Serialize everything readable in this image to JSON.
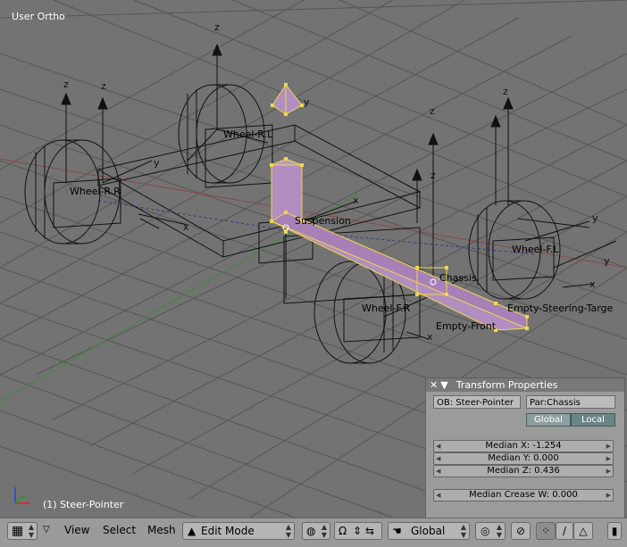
{
  "viewport": {
    "view_name": "User Ortho",
    "object_name": "(1) Steer-Pointer",
    "labels": {
      "suspension": "Suspension",
      "chassis": "Chassis",
      "empty_front": "Empty-Front",
      "empty_steering_target": "Empty-Steering-Targe",
      "wheel_fr": "Wheel-F.R",
      "wheel_fl": "Wheel-F.L",
      "wheel_rl": "Wheel-R.L",
      "wheel_rr": "Wheel-R.R"
    },
    "axis_letters": {
      "z": "z",
      "y": "y",
      "x": "x"
    }
  },
  "transform_panel": {
    "title": "Transform Properties",
    "ob_field": "OB: Steer-Pointer",
    "par_field": "Par:Chassis",
    "global_label": "Global",
    "local_label": "Local",
    "median_x": "Median X: -1.254",
    "median_y": "Median Y: 0.000",
    "median_z": "Median Z: 0.436",
    "median_crease": "Median Crease W: 0.000"
  },
  "header": {
    "menu_view": "View",
    "menu_select": "Select",
    "menu_mesh": "Mesh",
    "mode_label": "Edit Mode",
    "orientation_label": "Global"
  },
  "colors": {
    "viewport_bg": "#737373",
    "selection_fill": "#b08fc0",
    "selection_edge": "#f0d64a",
    "panel_bg": "#9b9b9b"
  }
}
